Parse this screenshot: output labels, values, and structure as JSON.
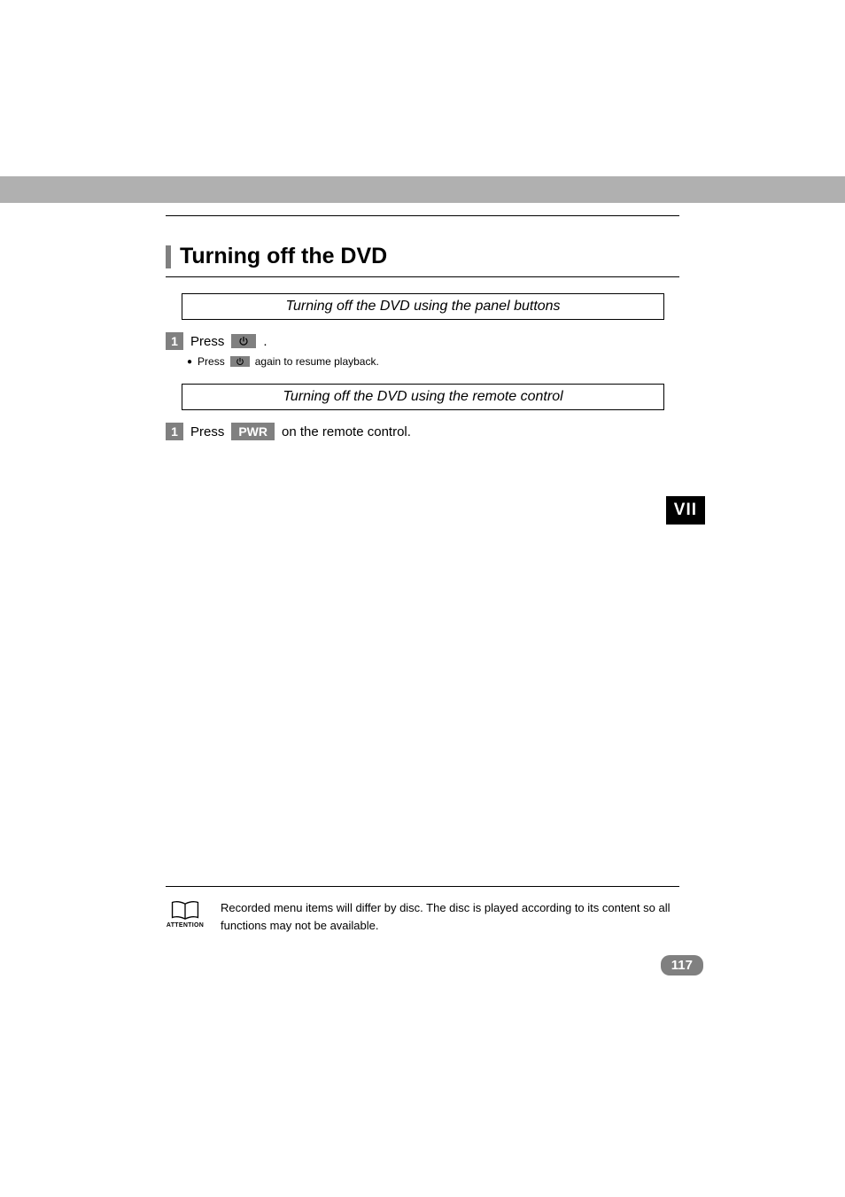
{
  "section": {
    "title": "Turning off the DVD"
  },
  "sub1": {
    "heading": "Turning off the DVD using the panel buttons",
    "step1_num": "1",
    "press": "Press",
    "period": ".",
    "bullet_press": "Press",
    "bullet_rest": "again to resume playback."
  },
  "sub2": {
    "heading": "Turning off the DVD using the remote control",
    "step1_num": "1",
    "press": "Press",
    "pwr": "PWR",
    "rest": "on the remote control."
  },
  "side_tab": "VII",
  "attention": {
    "label": "ATTENTION",
    "text": "Recorded menu items will differ by disc. The disc is played according to its content so all functions may not be available."
  },
  "page_number": "117"
}
